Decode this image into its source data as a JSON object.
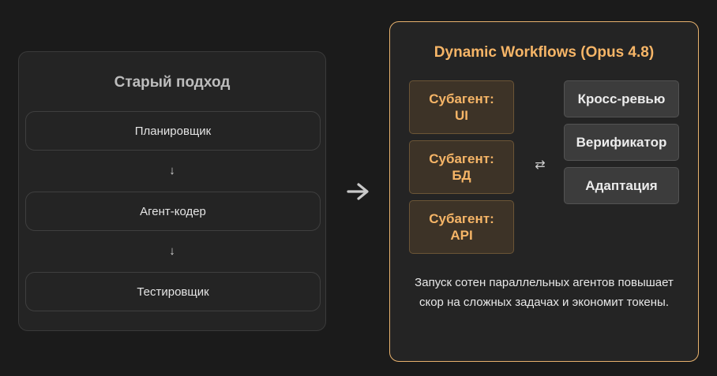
{
  "old_approach": {
    "title": "Старый подход",
    "steps": [
      "Планировщик",
      "Агент-кодер",
      "Тестировщик"
    ],
    "arrow_glyph": "↓"
  },
  "transition_icon": "right-arrow-icon",
  "dynamic_workflows": {
    "title": "Dynamic Workflows (Opus 4.8)",
    "subagents": [
      "Субагент: UI",
      "Субагент: БД",
      "Субагент: API"
    ],
    "exchange_glyph": "⇄",
    "roles": [
      "Кросс-ревью",
      "Верификатор",
      "Адаптация"
    ],
    "caption": "Запуск сотен параллельных агентов повышает скор на сложных задачах и экономит токены."
  },
  "colors": {
    "background": "#1b1b1b",
    "panel": "#242424",
    "accent": "#f6b567",
    "accent_border": "#e8b26e",
    "subagent_fill": "#3d3327",
    "role_fill": "#3c3c3c"
  }
}
